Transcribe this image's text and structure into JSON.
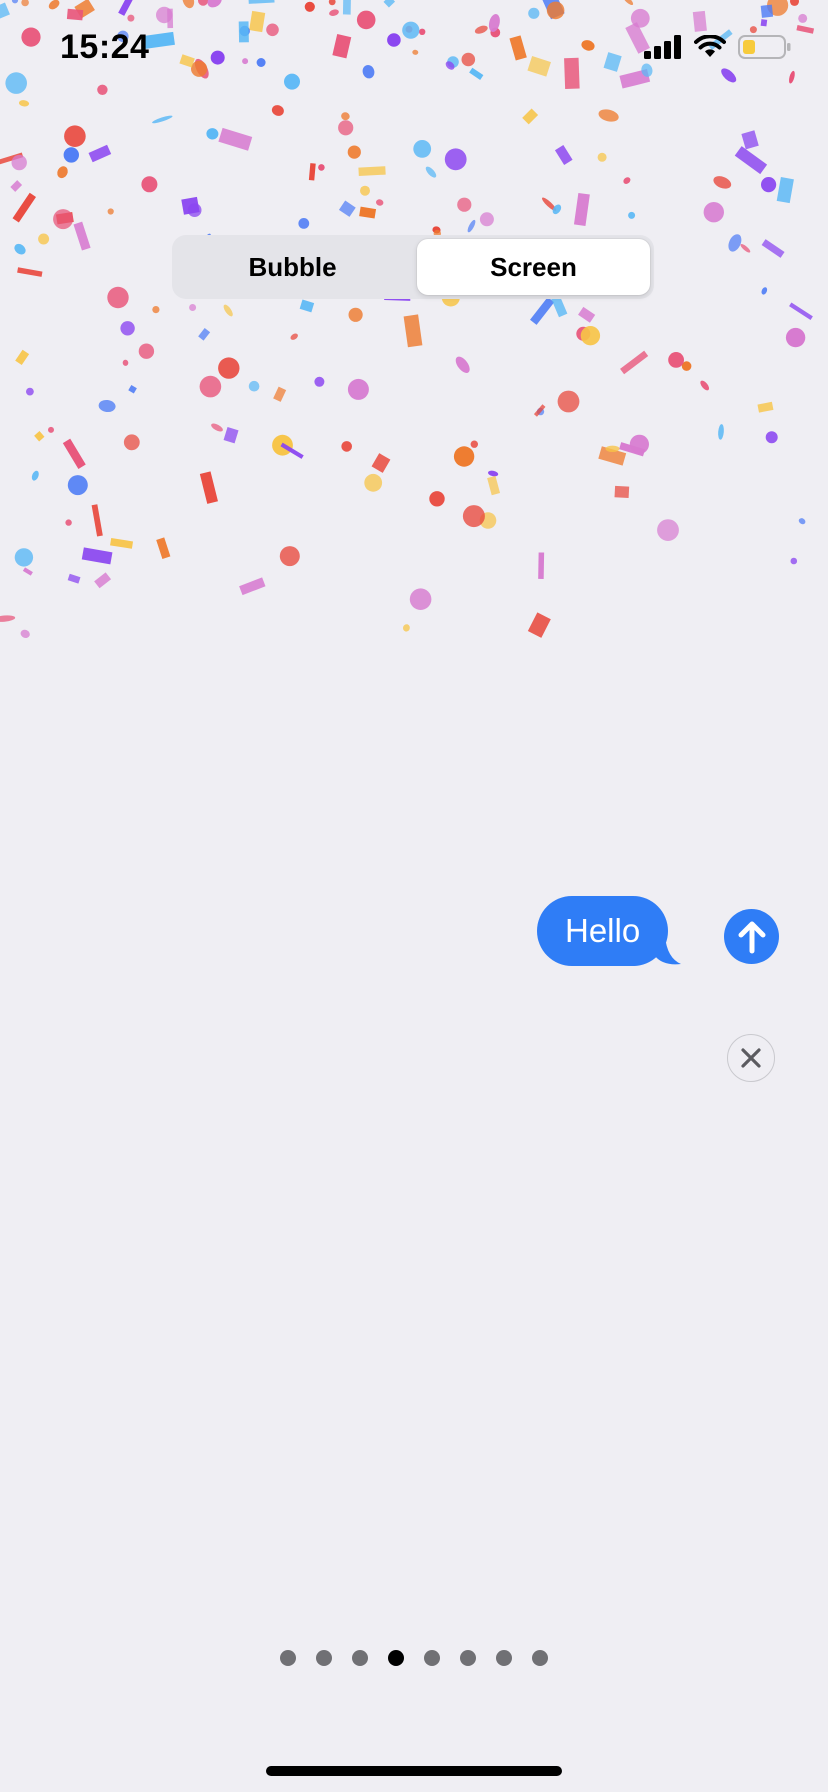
{
  "status_bar": {
    "time": "15:24",
    "icons": [
      "cellular-signal-icon",
      "wifi-icon",
      "battery-low-icon"
    ]
  },
  "effect_picker": {
    "segments": [
      {
        "label": "Bubble",
        "selected": false
      },
      {
        "label": "Screen",
        "selected": true
      }
    ]
  },
  "preview": {
    "effect": "confetti",
    "message_text": "Hello",
    "send_icon": "arrow-up-icon",
    "cancel_icon": "close-icon"
  },
  "pager": {
    "page_count": 8,
    "current_page": 4
  },
  "colors": {
    "background": "#efeef3",
    "accent": "#2f7df6",
    "segment_track": "#e4e4e9",
    "battery_fill": "#f7cb3c",
    "confetti": [
      "#e8557a",
      "#4f7df5",
      "#5ab8f5",
      "#f7c446",
      "#e8463a",
      "#8a45f0",
      "#d77bd0",
      "#ee7b2f"
    ]
  }
}
